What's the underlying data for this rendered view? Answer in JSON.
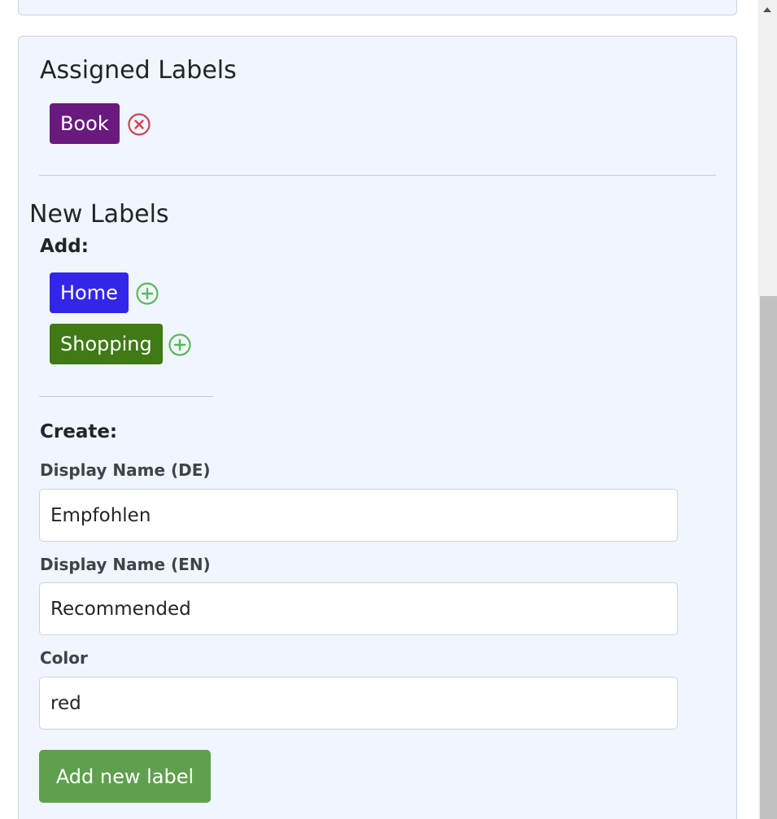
{
  "assigned": {
    "title": "Assigned Labels",
    "labels": [
      {
        "name": "Book",
        "color": "#6a1a7e"
      }
    ]
  },
  "new_labels": {
    "title": "New Labels",
    "add_title": "Add:",
    "addable": [
      {
        "name": "Home",
        "color": "#3326e8"
      },
      {
        "name": "Shopping",
        "color": "#3f7a14"
      }
    ],
    "create_title": "Create:",
    "fields": {
      "display_name_de": {
        "label": "Display Name (DE)",
        "value": "Empfohlen"
      },
      "display_name_en": {
        "label": "Display Name (EN)",
        "value": "Recommended"
      },
      "color": {
        "label": "Color",
        "value": "red"
      }
    },
    "submit_label": "Add new label"
  },
  "icons": {
    "remove": "remove-circle-x-icon",
    "add": "add-circle-plus-icon"
  },
  "colors": {
    "remove_icon": "#c9454f",
    "add_icon": "#5cb85c",
    "submit_button": "#5fa04e",
    "card_bg": "#f0f5fe"
  }
}
